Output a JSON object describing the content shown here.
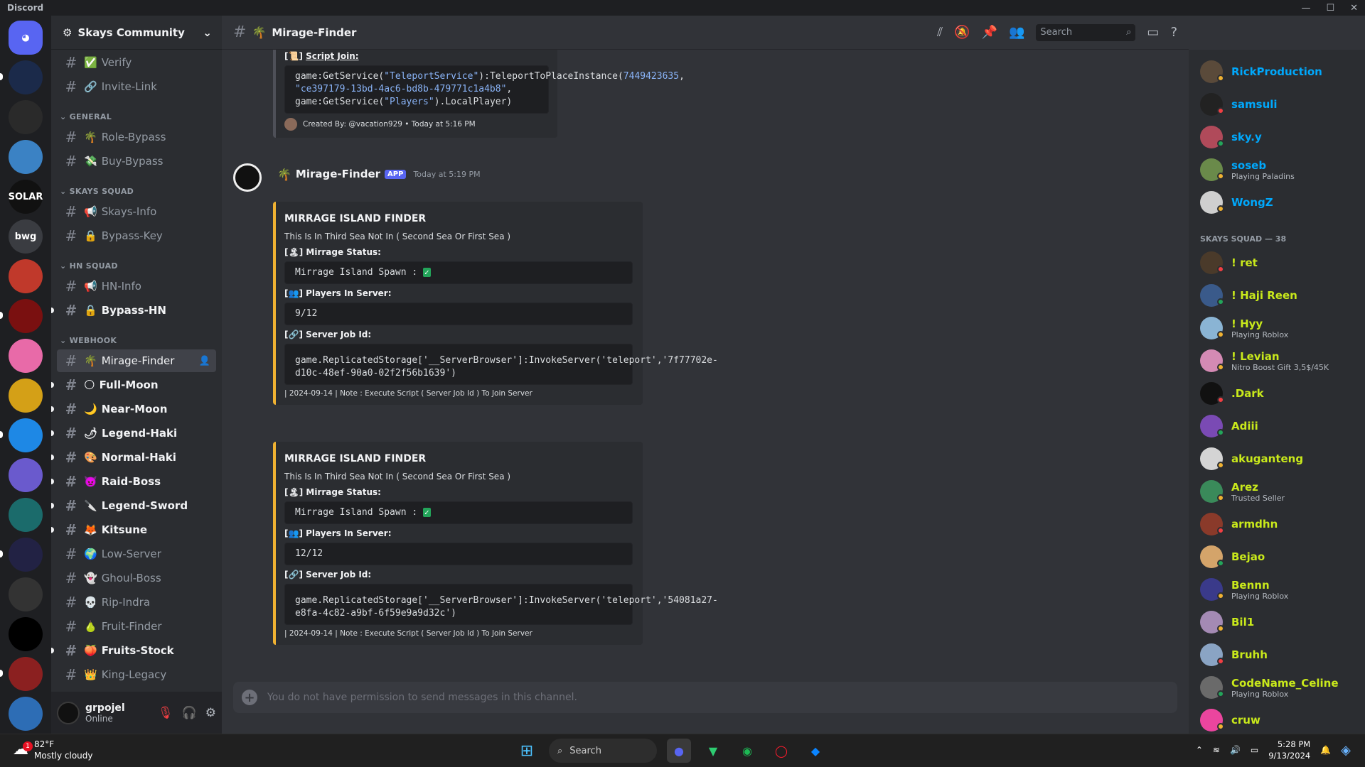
{
  "app": {
    "title": "Discord"
  },
  "guild": {
    "name": "Skays Community"
  },
  "servers": [
    {
      "label": "",
      "color": "#5865f2",
      "icon": "discord-logo-icon"
    },
    {
      "label": "",
      "color": "#1b2a4a"
    },
    {
      "label": "",
      "color": "#2a2a2a"
    },
    {
      "label": "",
      "color": "#3b82c4"
    },
    {
      "label": "SOLAR",
      "color": "#111111"
    },
    {
      "label": "bwg",
      "color": "#3a3c41"
    },
    {
      "label": "",
      "color": "#c0392b"
    },
    {
      "label": "",
      "color": "#7a1010"
    },
    {
      "label": "",
      "color": "#e86aa8"
    },
    {
      "label": "",
      "color": "#d4a017"
    },
    {
      "label": "",
      "color": "#1e88e5"
    },
    {
      "label": "",
      "color": "#6a5acd"
    },
    {
      "label": "",
      "color": "#1b6b6b"
    },
    {
      "label": "",
      "color": "#222244"
    },
    {
      "label": "",
      "color": "#333333"
    },
    {
      "label": "",
      "color": "#000000"
    },
    {
      "label": "",
      "color": "#8b2020"
    },
    {
      "label": "",
      "color": "#2d6db5"
    }
  ],
  "channels": {
    "top": [
      {
        "name": "Verify",
        "emoji": "✅"
      },
      {
        "name": "Invite-Link",
        "emoji": "🔗"
      }
    ],
    "categories": [
      {
        "name": "GENERAL",
        "items": [
          {
            "name": "Role-Bypass",
            "emoji": "🌴",
            "unread": false
          },
          {
            "name": "Buy-Bypass",
            "emoji": "💸",
            "unread": false
          }
        ]
      },
      {
        "name": "SKAYS SQUAD",
        "items": [
          {
            "name": "Skays-Info",
            "emoji": "📢",
            "unread": false
          },
          {
            "name": "Bypass-Key",
            "emoji": "🔒",
            "unread": false
          }
        ]
      },
      {
        "name": "HN SQUAD",
        "items": [
          {
            "name": "HN-Info",
            "emoji": "📢",
            "unread": false
          },
          {
            "name": "Bypass-HN",
            "emoji": "🔒",
            "unread": true
          }
        ]
      },
      {
        "name": "WEBHOOK",
        "items": [
          {
            "name": "Mirage-Finder",
            "emoji": "🌴",
            "unread": false,
            "active": true
          },
          {
            "name": "Full-Moon",
            "emoji": "🌕",
            "unread": true
          },
          {
            "name": "Near-Moon",
            "emoji": "🌙",
            "unread": true
          },
          {
            "name": "Legend-Haki",
            "emoji": "🌶",
            "unread": true
          },
          {
            "name": "Normal-Haki",
            "emoji": "🎨",
            "unread": true
          },
          {
            "name": "Raid-Boss",
            "emoji": "👿",
            "unread": true
          },
          {
            "name": "Legend-Sword",
            "emoji": "🔪",
            "unread": true
          },
          {
            "name": "Kitsune",
            "emoji": "🦊",
            "unread": true
          },
          {
            "name": "Low-Server",
            "emoji": "🌍",
            "unread": false
          },
          {
            "name": "Ghoul-Boss",
            "emoji": "👻",
            "unread": false
          },
          {
            "name": "Rip-Indra",
            "emoji": "💀",
            "unread": false
          },
          {
            "name": "Fruit-Finder",
            "emoji": "🍐",
            "unread": false
          },
          {
            "name": "Fruits-Stock",
            "emoji": "🍑",
            "unread": true
          },
          {
            "name": "King-Legacy",
            "emoji": "👑",
            "unread": false
          }
        ]
      }
    ]
  },
  "user": {
    "name": "grpojel",
    "status": "Online"
  },
  "header": {
    "channel": "Mirage-Finder",
    "emoji": "🌴",
    "search_placeholder": "Search"
  },
  "prev": {
    "field": "Script Join:",
    "code_a": "game:GetService(",
    "code_s1": "\"TeleportService\"",
    "code_b": "):TeleportToPlaceInstance(",
    "code_n": "7449423635",
    "code_c": ", ",
    "code_s2": "\"ce397179-13bd-4ac6-bd8b-479771c1a4b8\"",
    "code_d": ",\ngame:GetService(",
    "code_s3": "\"Players\"",
    "code_e": ").LocalPlayer)",
    "footer": "Created By: @vacation929 • Today at 5:16 PM"
  },
  "message": {
    "author": "Mirage-Finder",
    "badge": "APP",
    "time": "Today at 5:19 PM"
  },
  "embeds": [
    {
      "title": "MIRRAGE ISLAND FINDER",
      "desc": "This Is In Third Sea Not In ( Second Sea Or First Sea )",
      "f1": "Mirrage Status:",
      "f1v": "Mirrage Island Spawn :",
      "f2": "Players In Server:",
      "f2v": "9/12",
      "f3": "Server Job Id:",
      "f3v": "game.ReplicatedStorage['__ServerBrowser']:InvokeServer('teleport','7f77702e-d10c-48ef-90a0-02f2f56b1639')",
      "footer": "| 2024-09-14 | Note : Execute Script ( Server Job Id ) To Join Server"
    },
    {
      "title": "MIRRAGE ISLAND FINDER",
      "desc": "This Is In Third Sea Not In ( Second Sea Or First Sea )",
      "f1": "Mirrage Status:",
      "f1v": "Mirrage Island Spawn :",
      "f2": "Players In Server:",
      "f2v": "12/12",
      "f3": "Server Job Id:",
      "f3v": "game.ReplicatedStorage['__ServerBrowser']:InvokeServer('teleport','54081a27-e8fa-4c82-a9bf-6f59e9a9d32c')",
      "footer": "| 2024-09-14 | Note : Execute Script ( Server Job Id ) To Join Server"
    }
  ],
  "composer": {
    "placeholder": "You do not have permission to send messages in this channel."
  },
  "members": {
    "group1": [
      {
        "name": "RickProduction",
        "sub": "",
        "color": "#00a8fc",
        "av": "#5a4a3a"
      },
      {
        "name": "samsuli",
        "sub": "",
        "color": "#00a8fc",
        "av": "#222222"
      },
      {
        "name": "sky.y",
        "sub": "",
        "color": "#00a8fc",
        "av": "#b04a5a"
      },
      {
        "name": "soseb",
        "sub": "Playing Paladins",
        "color": "#00a8fc",
        "av": "#6a8a4a"
      },
      {
        "name": "WongZ",
        "sub": "",
        "color": "#00a8fc",
        "av": "#cfcfcf"
      }
    ],
    "cat2": "SKAYS SQUAD — 38",
    "group2": [
      {
        "name": "! ret",
        "sub": "",
        "color": "#c9e91b",
        "av": "#4a3a2a"
      },
      {
        "name": "! Haji Reen",
        "sub": "",
        "color": "#c9e91b",
        "av": "#3a5a8a"
      },
      {
        "name": "! Hyy",
        "sub": "Playing Roblox",
        "color": "#c9e91b",
        "av": "#8ab4d4"
      },
      {
        "name": "! Levian",
        "sub": "Nitro Boost Gift 3,5$/45K",
        "color": "#c9e91b",
        "av": "#d48ab4"
      },
      {
        "name": ".Dark",
        "sub": "",
        "color": "#c9e91b",
        "av": "#111111"
      },
      {
        "name": "Adiii",
        "sub": "",
        "color": "#c9e91b",
        "av": "#7a4ab4"
      },
      {
        "name": "akuganteng",
        "sub": "",
        "color": "#c9e91b",
        "av": "#d4d4d4"
      },
      {
        "name": "Arez",
        "sub": "Trusted Seller",
        "color": "#c9e91b",
        "av": "#3a8a5a"
      },
      {
        "name": "armdhn",
        "sub": "",
        "color": "#c9e91b",
        "av": "#8a3a2a"
      },
      {
        "name": "Bejao",
        "sub": "",
        "color": "#c9e91b",
        "av": "#d4a46a"
      },
      {
        "name": "Bennn",
        "sub": "Playing Roblox",
        "color": "#c9e91b",
        "av": "#3a3a8a"
      },
      {
        "name": "Bil1",
        "sub": "",
        "color": "#c9e91b",
        "av": "#a48ab4"
      },
      {
        "name": "Bruhh",
        "sub": "",
        "color": "#c9e91b",
        "av": "#8aa4c4"
      },
      {
        "name": "CodeName_Celine",
        "sub": "Playing Roblox",
        "color": "#c9e91b",
        "av": "#6a6a6a"
      },
      {
        "name": "cruw",
        "sub": "",
        "color": "#c9e91b",
        "av": "#eb459e"
      }
    ]
  },
  "taskbar": {
    "temp": "82°F",
    "weather": "Mostly cloudy",
    "alert": "1",
    "search": "Search",
    "time": "5:28 PM",
    "date": "9/13/2024"
  }
}
